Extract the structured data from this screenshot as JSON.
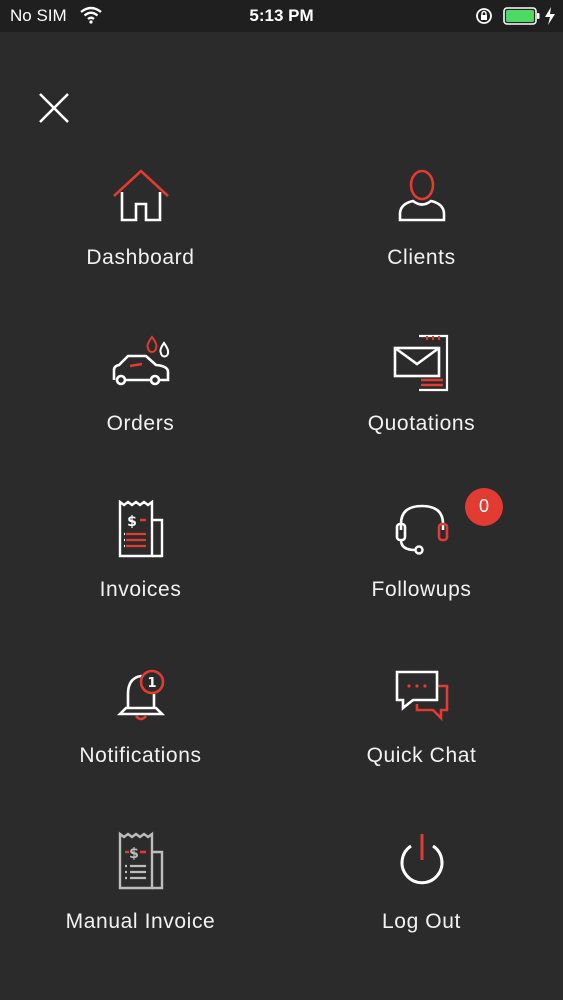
{
  "status_bar": {
    "carrier": "No SIM",
    "time": "5:13 PM"
  },
  "menu": {
    "items": [
      {
        "label": "Dashboard",
        "icon": "home-icon"
      },
      {
        "label": "Clients",
        "icon": "user-icon"
      },
      {
        "label": "Orders",
        "icon": "car-wash-icon"
      },
      {
        "label": "Quotations",
        "icon": "envelope-document-icon"
      },
      {
        "label": "Invoices",
        "icon": "invoice-icon"
      },
      {
        "label": "Followups",
        "icon": "headset-icon"
      },
      {
        "label": "Notifications",
        "icon": "bell-icon"
      },
      {
        "label": "Quick Chat",
        "icon": "chat-bubbles-icon"
      },
      {
        "label": "Manual Invoice",
        "icon": "manual-invoice-icon"
      },
      {
        "label": "Log Out",
        "icon": "power-icon"
      }
    ],
    "followups_badge": "0",
    "notifications_badge": "1"
  },
  "colors": {
    "background": "#2b2b2b",
    "status_bar": "#1f1f1f",
    "accent": "#e23b31",
    "icon_stroke": "#ffffff",
    "battery": "#4cd964"
  }
}
